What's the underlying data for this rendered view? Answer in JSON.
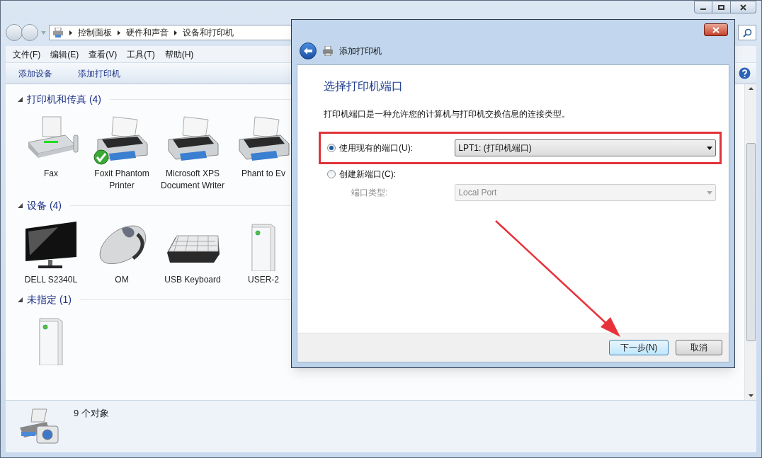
{
  "explorer": {
    "breadcrumb": [
      "控制面板",
      "硬件和声音",
      "设备和打印机"
    ],
    "menu": [
      "文件(F)",
      "编辑(E)",
      "查看(V)",
      "工具(T)",
      "帮助(H)"
    ],
    "commands": [
      "添加设备",
      "添加打印机"
    ],
    "groups": [
      {
        "title": "打印机和传真 (4)",
        "expanded": true,
        "items": [
          {
            "kind": "fax",
            "label": "Fax",
            "default": false
          },
          {
            "kind": "printer",
            "label": "Foxit Phantom Printer",
            "default": true
          },
          {
            "kind": "printer",
            "label": "Microsoft XPS Document Writer",
            "default": false
          },
          {
            "kind": "printer",
            "label": "Phant to Ev",
            "default": false
          }
        ]
      },
      {
        "title": "设备 (4)",
        "expanded": true,
        "items": [
          {
            "kind": "monitor",
            "label": "DELL S2340L",
            "default": false
          },
          {
            "kind": "mouse",
            "label": "OM",
            "default": false
          },
          {
            "kind": "keyboard",
            "label": "USB Keyboard",
            "default": false
          },
          {
            "kind": "tower",
            "label": "USER-2",
            "default": false
          }
        ]
      },
      {
        "title": "未指定 (1)",
        "expanded": true,
        "items": [
          {
            "kind": "tower",
            "default": false
          }
        ]
      }
    ],
    "status": "9 个对象"
  },
  "dialog": {
    "title": "添加打印机",
    "heading": "选择打印机端口",
    "description": "打印机端口是一种允许您的计算机与打印机交换信息的连接类型。",
    "options": [
      {
        "label": "使用现有的端口(U):",
        "selected": true,
        "highlighted": true,
        "select": {
          "value": "LPT1: (打印机端口)",
          "disabled": false
        }
      },
      {
        "label": "创建新端口(C):",
        "selected": false,
        "highlighted": false,
        "sublabel": "端口类型:",
        "select": {
          "value": "Local Port",
          "disabled": true
        }
      }
    ],
    "buttons": [
      {
        "label": "下一步(N)",
        "default": true
      },
      {
        "label": "取消",
        "default": false
      }
    ]
  }
}
